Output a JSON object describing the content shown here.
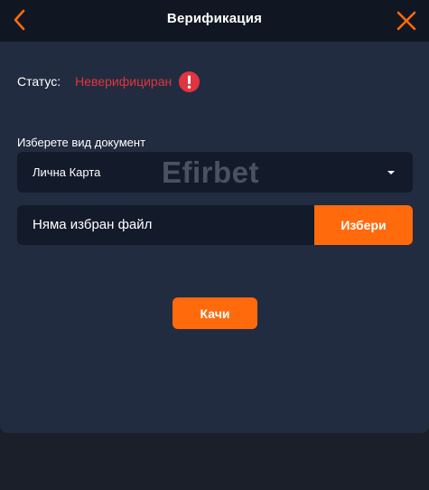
{
  "header": {
    "title": "Верификация",
    "back_icon": "chevron-left-icon",
    "close_icon": "close-icon"
  },
  "status": {
    "label": "Статус:",
    "value": "Неверифициран",
    "icon": "exclamation-circle-icon"
  },
  "document": {
    "label": "Изберете вид документ",
    "selected": "Лична Карта",
    "watermark": "Efirbet"
  },
  "file": {
    "placeholder": "Няма избран файл",
    "choose_label": "Избери"
  },
  "upload": {
    "label": "Качи"
  },
  "colors": {
    "accent": "#ff6a0d",
    "error": "#e0343f",
    "panel": "#222c40",
    "field": "#131b2a",
    "background": "#1b1f29"
  }
}
